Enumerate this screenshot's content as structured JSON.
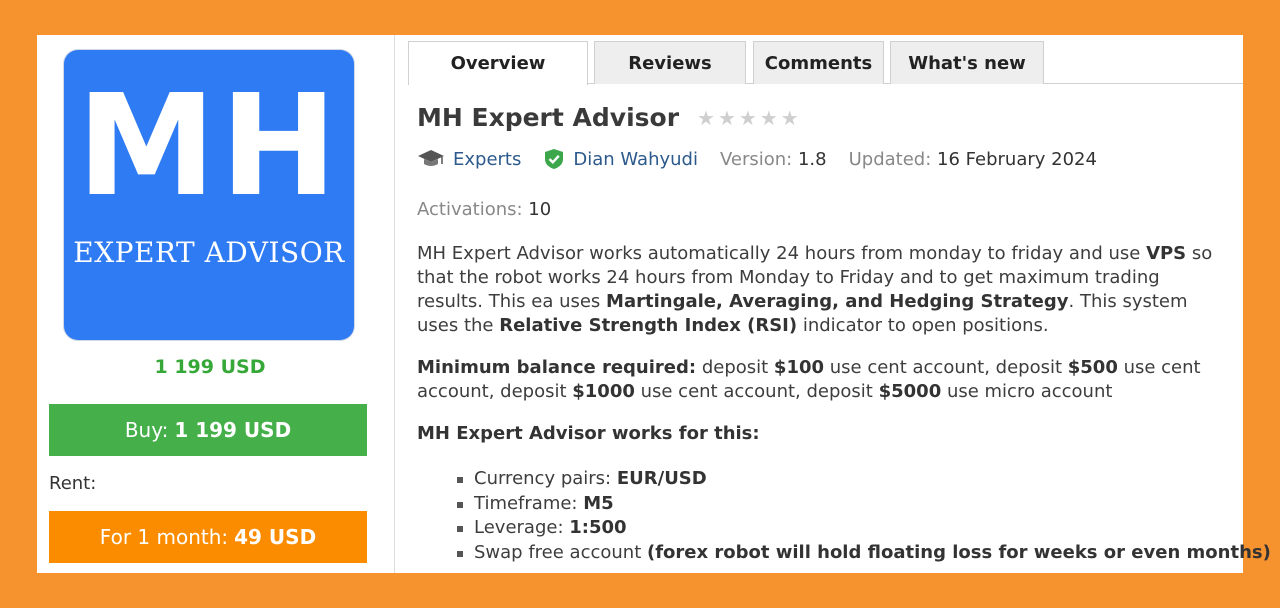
{
  "product": {
    "logo_main": "MH",
    "logo_sub": "EXPERT ADVISOR",
    "price": "1 199 USD",
    "buy_label": "Buy:",
    "buy_price": "1 199 USD",
    "rent_label": "Rent:",
    "rent_button_label": "For 1 month:",
    "rent_button_price": "49 USD"
  },
  "tabs": [
    {
      "label": "Overview",
      "active": true
    },
    {
      "label": "Reviews",
      "active": false
    },
    {
      "label": "Comments",
      "active": false
    },
    {
      "label": "What's new",
      "active": false
    }
  ],
  "title": "MH Expert Advisor",
  "rating": {
    "stars": 0,
    "max": 5
  },
  "meta": {
    "category": "Experts",
    "author": "Dian Wahyudi",
    "version_label": "Version:",
    "version": "1.8",
    "updated_label": "Updated:",
    "updated": "16 February 2024",
    "activations_label": "Activations:",
    "activations": "10"
  },
  "description": {
    "p1_a": "MH Expert Advisor works automatically 24 hours from monday to friday and use ",
    "p1_vps": "VPS",
    "p1_b": " so that the robot works 24 hours from Monday to Friday and to get maximum trading results. This ea uses ",
    "p1_strategy": "Martingale, Averaging, and Hedging Strategy",
    "p1_c": ". This system uses the ",
    "p1_rsi": "Relative Strength Index (RSI)",
    "p1_d": " indicator to open positions.",
    "p2_label": "Minimum balance required:",
    "p2_a": " deposit ",
    "p2_v1": "$100",
    "p2_b": " use cent account, deposit ",
    "p2_v2": "$500",
    "p2_c": " use cent account, deposit ",
    "p2_v3": "$1000",
    "p2_d": " use cent account, deposit ",
    "p2_v4": "$5000",
    "p2_e": " use micro account",
    "p3": "MH Expert Advisor works for this:"
  },
  "features": [
    {
      "label": "Currency pairs: ",
      "value": "EUR/USD"
    },
    {
      "label": "Timeframe: ",
      "value": "M5"
    },
    {
      "label": "Leverage: ",
      "value": "1:500"
    },
    {
      "label": "Swap free account ",
      "value": "(forex robot will hold floating loss for weeks or even months)"
    }
  ],
  "colors": {
    "background": "#F7932E",
    "logo_blue": "#2F7BF3",
    "buy_green": "#45B04A",
    "rent_orange": "#FB8C00",
    "price_green": "#36a838",
    "link": "#2c5a8c"
  }
}
